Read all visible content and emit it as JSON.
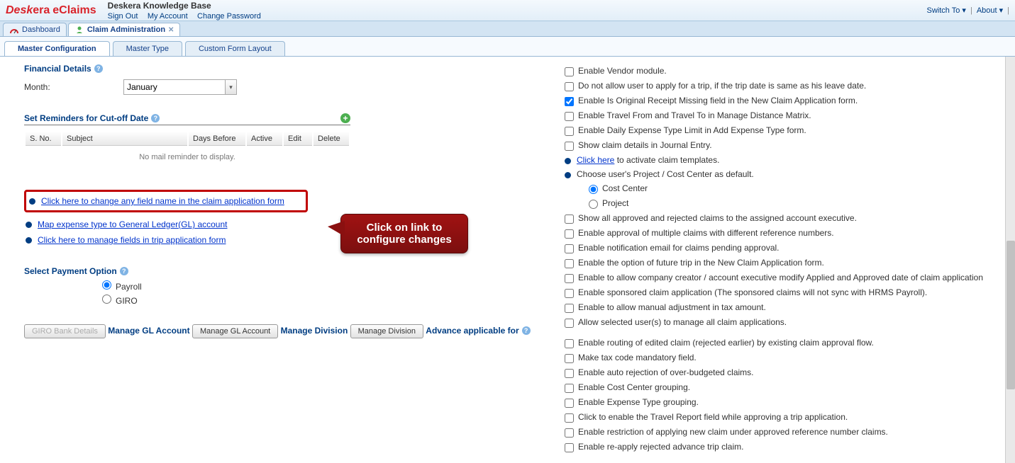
{
  "header": {
    "kb_title": "Deskera Knowledge Base",
    "sign_out": "Sign Out",
    "my_account": "My Account",
    "change_password": "Change Password",
    "switch_to": "Switch To",
    "about": "About"
  },
  "win_tabs": {
    "dashboard": "Dashboard",
    "claim_admin": "Claim Administration"
  },
  "sub_tabs": {
    "master_config": "Master Configuration",
    "master_type": "Master Type",
    "custom_form": "Custom Form Layout"
  },
  "left": {
    "financial_details": "Financial Details",
    "month_label": "Month:",
    "month_value": "January",
    "reminders_title": "Set Reminders for Cut-off Date",
    "table": {
      "sno": "S. No.",
      "subject": "Subject",
      "days_before": "Days Before",
      "active": "Active",
      "edit": "Edit",
      "delete": "Delete",
      "empty": "No mail reminder to display."
    },
    "link1": "Click here to change any field name in the claim application form",
    "link2": "Map expense type to General Ledger(GL) account",
    "link3": "Click here to manage fields in trip application form",
    "callout_l1": "Click on link to",
    "callout_l2": "configure changes",
    "select_payment": "Select Payment Option",
    "payroll": "Payroll",
    "giro": "GIRO",
    "giro_btn": "GIRO Bank Details",
    "manage_gl": "Manage GL Account",
    "manage_gl_btn": "Manage GL Account",
    "manage_div": "Manage Division",
    "manage_div_btn": "Manage Division",
    "advance_applicable": "Advance applicable for"
  },
  "right": {
    "r1": "Enable Vendor module.",
    "r2": "Do not allow user to apply for a trip, if the trip date is same as his leave date.",
    "r3": "Enable Is Original Receipt Missing field in the New Claim Application form.",
    "r4": "Enable Travel From and Travel To in Manage Distance Matrix.",
    "r5": "Enable Daily Expense Type Limit in Add Expense Type form.",
    "r6": "Show claim details in Journal Entry.",
    "r7_link": "Click here",
    "r7_rest": " to activate claim templates.",
    "r8": "Choose user's Project / Cost Center as default.",
    "r8a": "Cost Center",
    "r8b": "Project",
    "r9": "Show all approved and rejected claims to the assigned account executive.",
    "r10": "Enable approval of multiple claims with different reference numbers.",
    "r11": "Enable notification email for claims pending approval.",
    "r12": "Enable the option of future trip in the New Claim Application form.",
    "r13": "Enable to allow company creator / account executive modify Applied and Approved date of claim application",
    "r14": "Enable sponsored claim application (The sponsored claims will not sync with HRMS Payroll).",
    "r15": "Enable to allow manual adjustment in tax amount.",
    "r16": "Allow selected user(s) to manage all claim applications.",
    "r17": "Enable routing of edited claim (rejected earlier) by existing claim approval flow.",
    "r18": "Make tax code mandatory field.",
    "r19": "Enable auto rejection of over-budgeted claims.",
    "r20": "Enable Cost Center grouping.",
    "r21": "Enable Expense Type grouping.",
    "r22": "Click to enable the Travel Report field while approving a trip application.",
    "r23": "Enable restriction of applying new claim under approved reference number claims.",
    "r24": "Enable re-apply rejected advance trip claim."
  }
}
